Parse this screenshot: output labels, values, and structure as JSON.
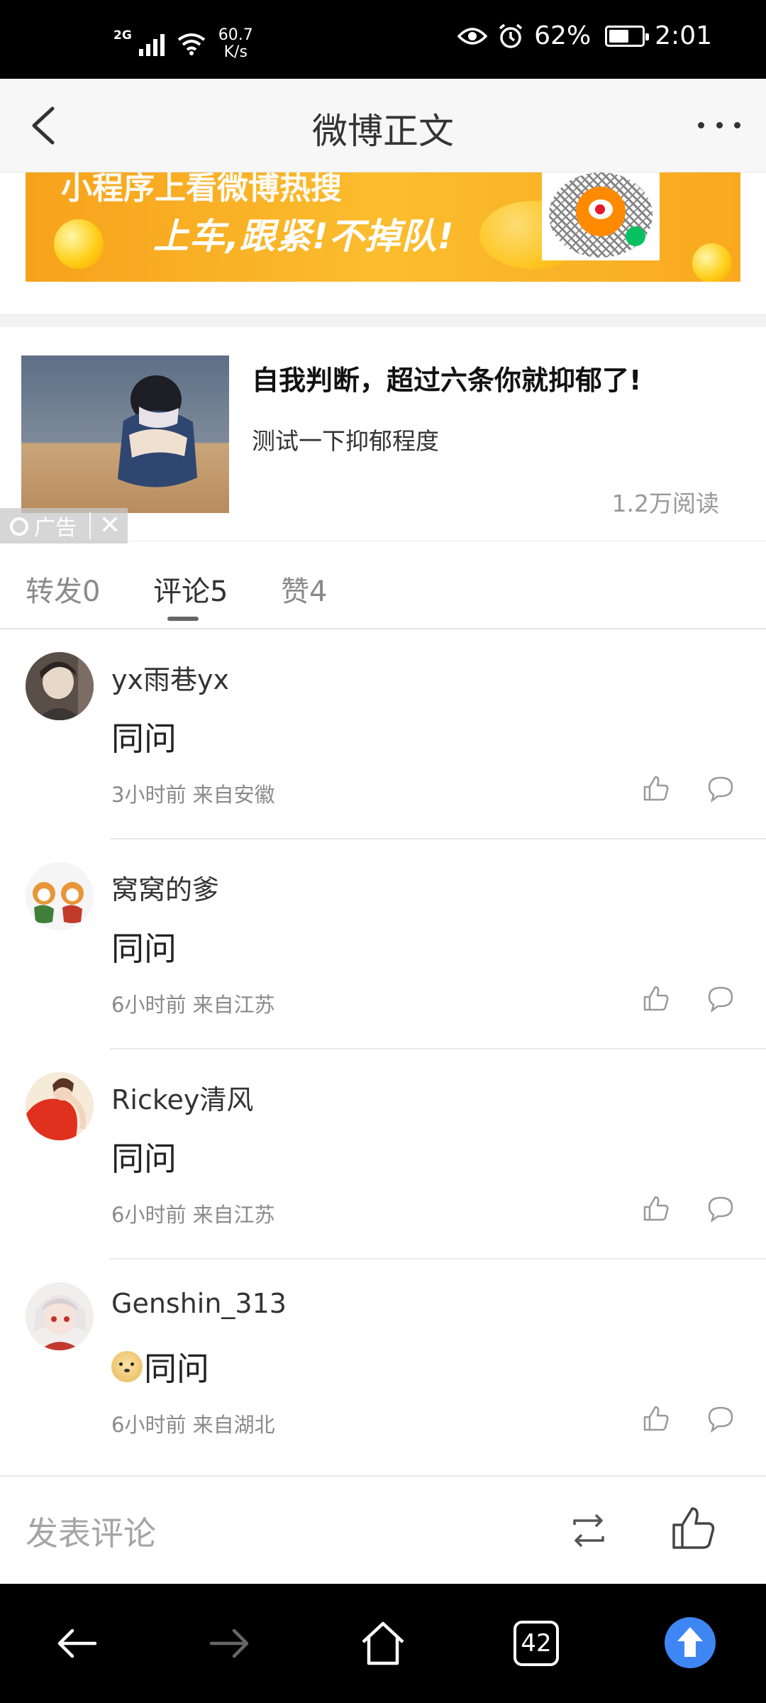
{
  "status_bar": {
    "network": "2G",
    "speed_value": "60.7",
    "speed_unit": "K/s",
    "battery": "62%",
    "time": "2:01",
    "battery_level": 0.62
  },
  "nav": {
    "title": "微博正文",
    "back_icon": "chevron-left-icon",
    "more_icon": "more-dots-icon"
  },
  "banner": {
    "line1": "小程序上看微博热搜",
    "line2": "上车,跟紧!不掉队!"
  },
  "ad": {
    "title": "自我判断，超过六条你就抑郁了!",
    "subtitle": "测试一下抑郁程度",
    "reads": "1.2万阅读",
    "tag": "广告",
    "close": "✕"
  },
  "tabs": [
    {
      "label": "转发0",
      "active": false
    },
    {
      "label": "评论5",
      "active": true
    },
    {
      "label": "赞4",
      "active": false
    }
  ],
  "comments": [
    {
      "name": "yx雨巷yx",
      "text": "同问",
      "meta": "3小时前 来自安徽",
      "emoji": false
    },
    {
      "name": "窝窝的爹",
      "text": "同问",
      "meta": "6小时前 来自江苏",
      "emoji": false
    },
    {
      "name": "Rickey清风",
      "text": "同问",
      "meta": "6小时前 来自江苏",
      "emoji": false
    },
    {
      "name": "Genshin_313",
      "text": "同问",
      "meta": "6小时前 来自湖北",
      "emoji": true
    }
  ],
  "comment_bar": {
    "placeholder": "发表评论",
    "repost_icon": "repost-icon",
    "like_icon": "thumbs-up-icon"
  },
  "browser_bar": {
    "tab_count": "42"
  },
  "colors": {
    "accent_blue": "#3f86f5",
    "banner_orange": "#fbbd2e"
  }
}
